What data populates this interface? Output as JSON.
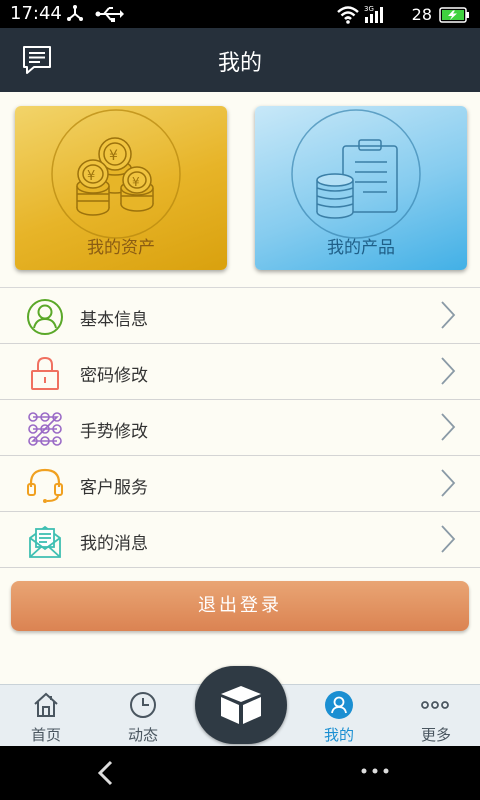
{
  "status_bar": {
    "time": "17:44",
    "battery": "28"
  },
  "header": {
    "title": "我的"
  },
  "cards": [
    {
      "label": "我的资产",
      "icon": "coins-icon"
    },
    {
      "label": "我的产品",
      "icon": "clipboard-coins-icon"
    }
  ],
  "menu": [
    {
      "label": "基本信息",
      "icon": "user-icon",
      "color": "#5aa829"
    },
    {
      "label": "密码修改",
      "icon": "lock-icon",
      "color": "#f07060"
    },
    {
      "label": "手势修改",
      "icon": "pattern-icon",
      "color": "#9a6ac6"
    },
    {
      "label": "客户服务",
      "icon": "headset-icon",
      "color": "#f0a020"
    },
    {
      "label": "我的消息",
      "icon": "mail-icon",
      "color": "#3fbfb2"
    }
  ],
  "logout": {
    "label": "退出登录"
  },
  "tabs": [
    {
      "label": "首页",
      "icon": "home-icon"
    },
    {
      "label": "动态",
      "icon": "clock-icon"
    },
    {
      "label": "我的",
      "icon": "profile-icon"
    },
    {
      "label": "更多",
      "icon": "more-icon"
    }
  ],
  "colors": {
    "header_bg": "#26303b",
    "accent": "#1b8fd2",
    "logout": "#df8a58"
  }
}
